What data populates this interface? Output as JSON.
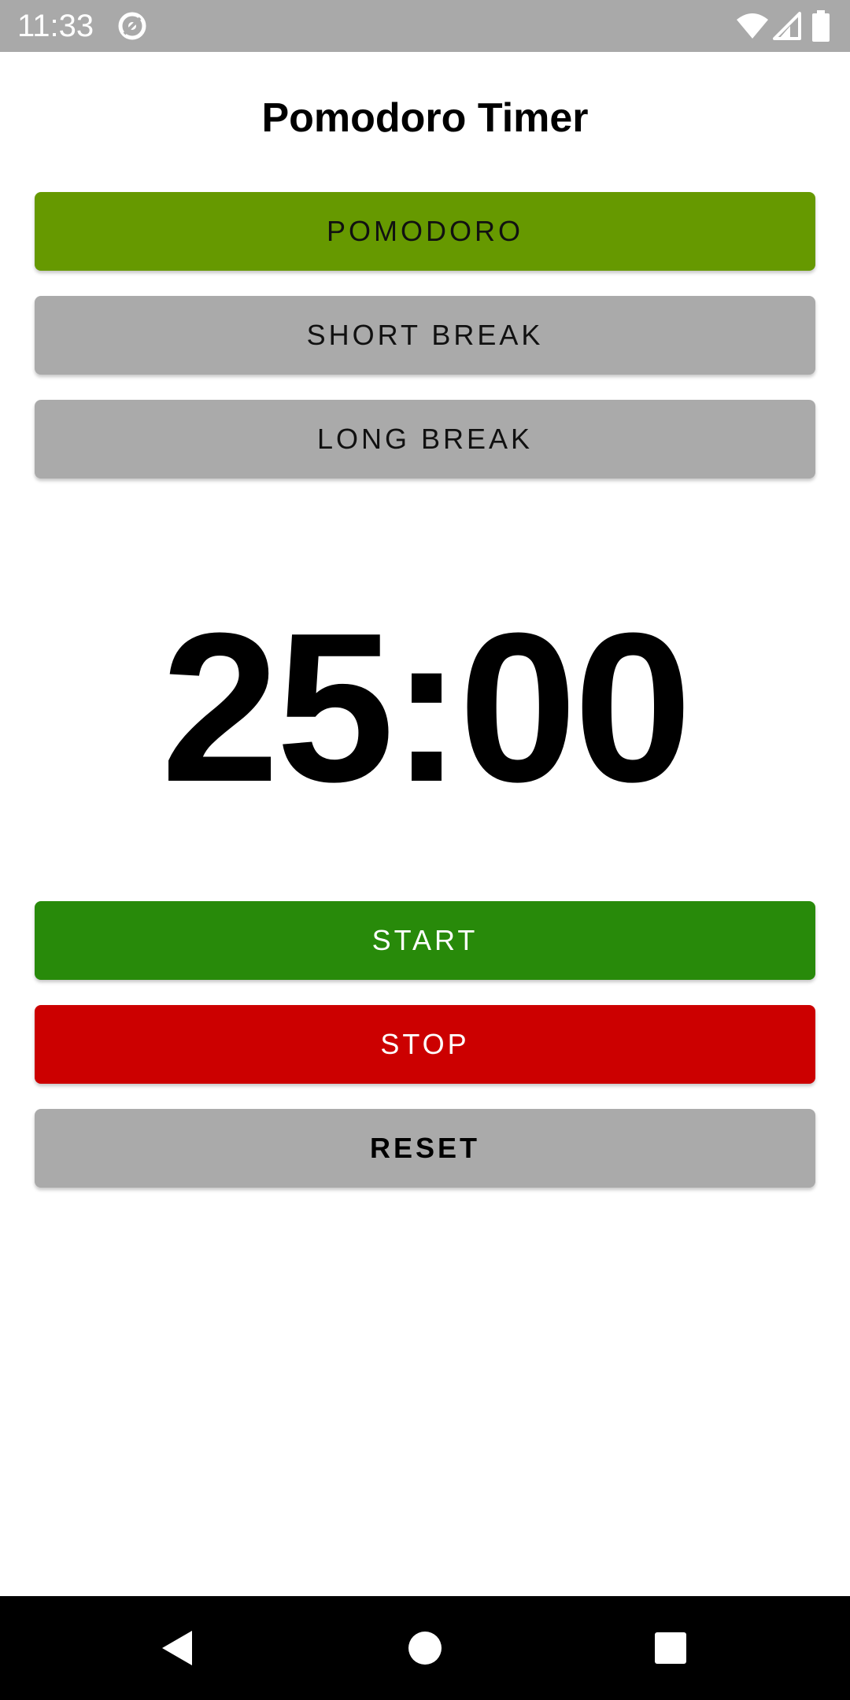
{
  "status_bar": {
    "time": "11:33",
    "icons": [
      "at-sign-icon",
      "wifi-icon",
      "signal-icon",
      "battery-icon"
    ]
  },
  "app": {
    "title": "Pomodoro Timer"
  },
  "modes": {
    "pomodoro_label": "POMODORO",
    "short_break_label": "SHORT BREAK",
    "long_break_label": "LONG BREAK",
    "selected": "POMODORO"
  },
  "timer": {
    "display": "25:00"
  },
  "controls": {
    "start_label": "START",
    "stop_label": "STOP",
    "reset_label": "RESET"
  },
  "nav_bar": {
    "icons": [
      "back-icon",
      "home-icon",
      "recents-icon"
    ]
  },
  "colors": {
    "status_bar": "#a9a9a9",
    "pomodoro_active": "#669900",
    "inactive_mode": "#aaaaaa",
    "start": "#288a0a",
    "stop": "#cc0000",
    "reset": "#aaaaaa"
  }
}
